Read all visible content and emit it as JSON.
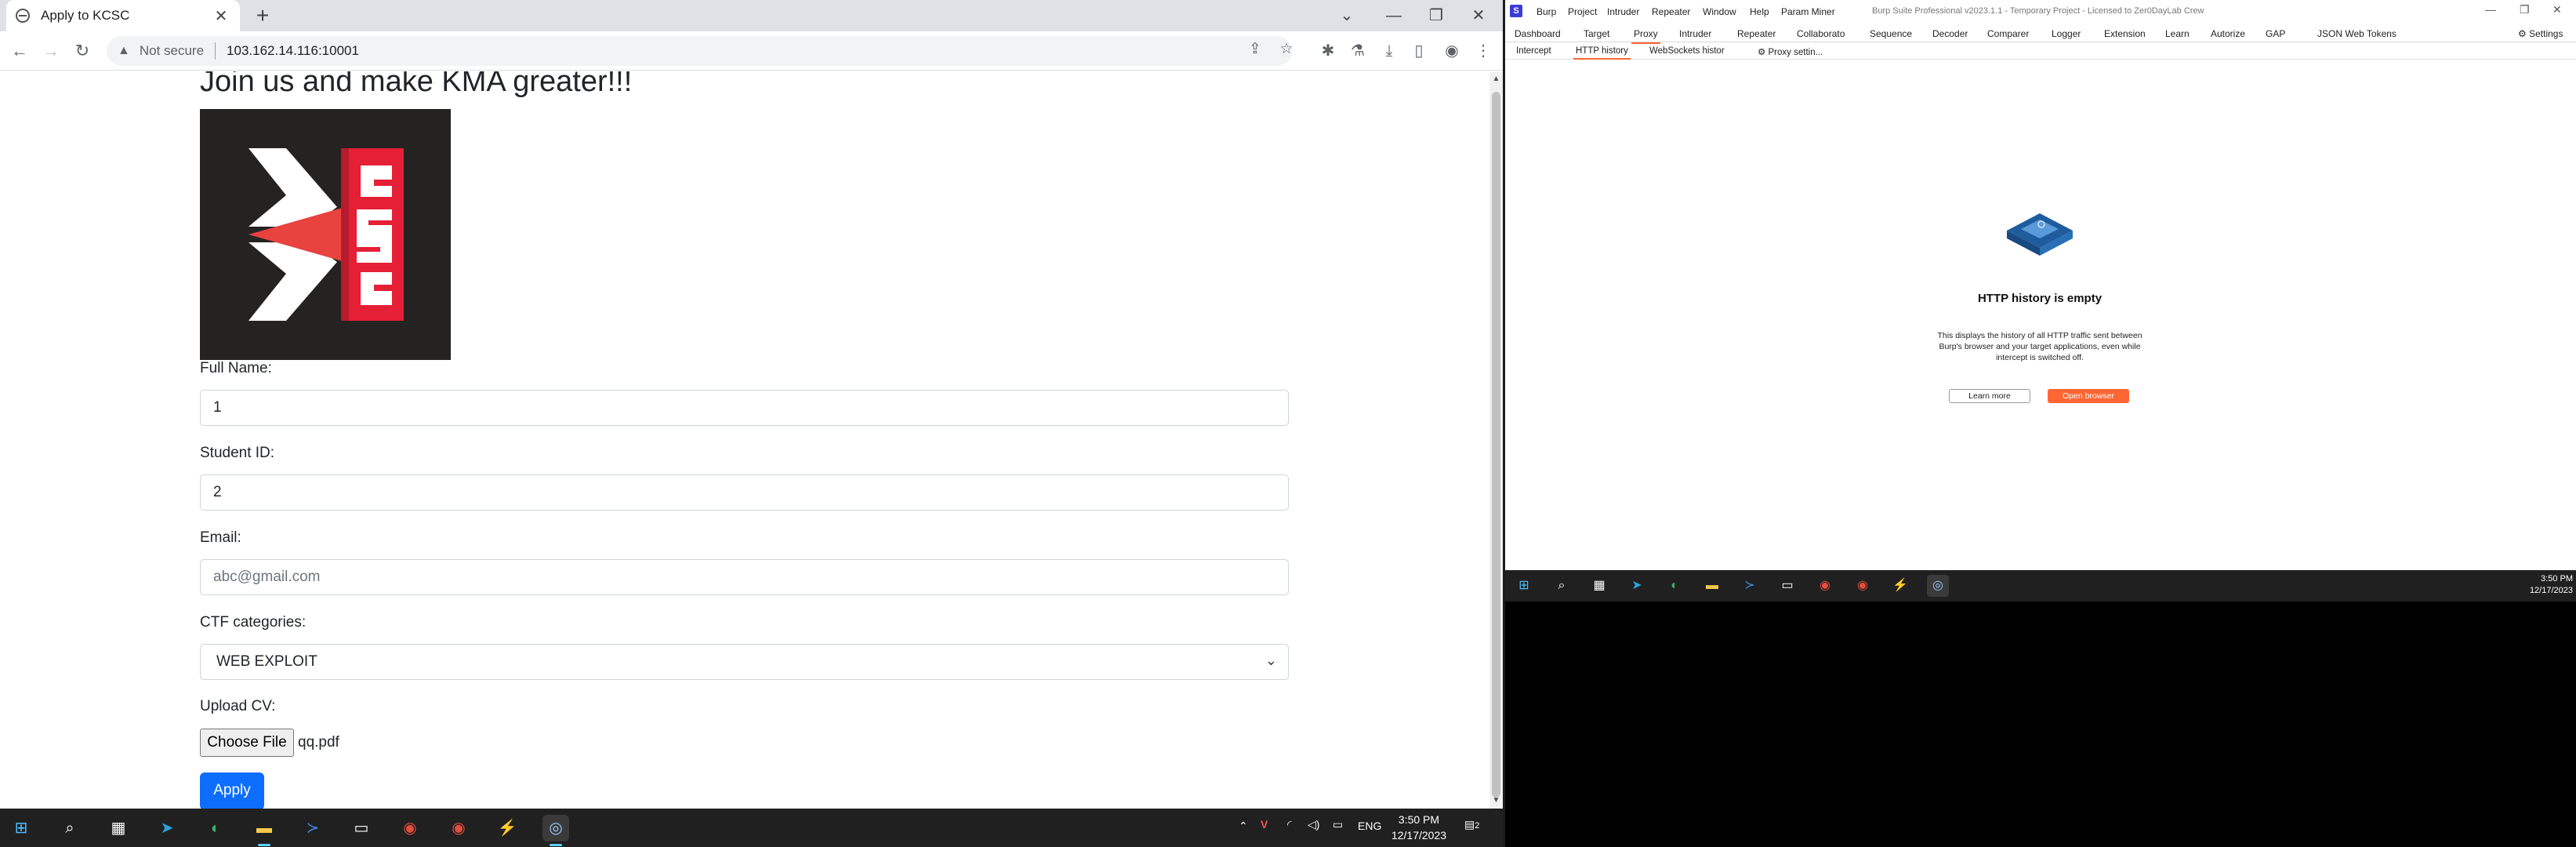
{
  "browser": {
    "tab_title": "Apply to KCSC",
    "tab_close": "✕",
    "new_tab": "+",
    "security_label": "Not secure",
    "url": "103.162.14.116:10001"
  },
  "page": {
    "heading": "Join us and make KMA greater!!!",
    "full_name_label": "Full Name:",
    "full_name_value": "1",
    "student_id_label": "Student ID:",
    "student_id_value": "2",
    "email_label": "Email:",
    "email_placeholder": "abc@gmail.com",
    "ctf_label": "CTF categories:",
    "ctf_selected": "WEB EXPLOIT",
    "cv_label": "Upload CV:",
    "choose_file": "Choose File",
    "file_name": "qq.pdf",
    "apply": "Apply"
  },
  "taskbar_left": {
    "time": "3:50 PM",
    "date": "12/17/2023",
    "lang": "ENG",
    "notif_count": "2"
  },
  "burp": {
    "window_title": "Burp Suite Professional v2023.1.1 - Temporary Project - Licensed to Zer0DayLab Crew",
    "menu": [
      "Burp",
      "Project",
      "Intruder",
      "Repeater",
      "Window",
      "Help",
      "Param Miner"
    ],
    "tabs": [
      "Dashboard",
      "Target",
      "Proxy",
      "Intruder",
      "Repeater",
      "Collaborato",
      "Sequence",
      "Decoder",
      "Comparer",
      "Logger",
      "Extension",
      "Learn",
      "Autorize",
      "GAP",
      "JSON Web Tokens"
    ],
    "settings": "Settings",
    "subtabs": [
      "Intercept",
      "HTTP history",
      "WebSockets histor",
      "Proxy settin..."
    ],
    "empty_title": "HTTP history is empty",
    "empty_desc": "This displays the history of all HTTP traffic sent between Burp's browser and your target applications, even while intercept is switched off.",
    "learn_more": "Learn more",
    "open_browser": "Open browser",
    "accent": "#ff6633"
  },
  "taskbar_right": {
    "time": "3:50 PM",
    "date": "12/17/2023"
  }
}
